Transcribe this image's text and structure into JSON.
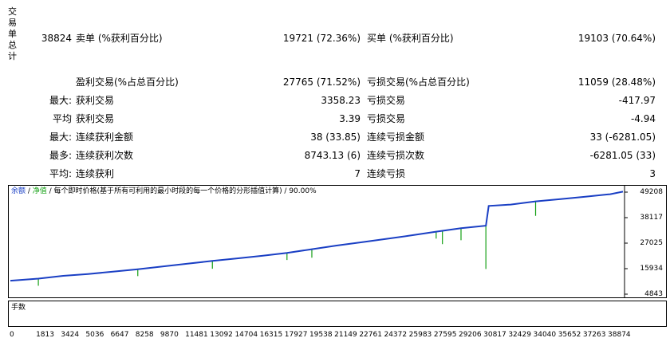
{
  "stats": {
    "side_label": "交易单总计",
    "total": "38824",
    "sell_label": "卖单 (%获利百分比)",
    "sell_value": "19721 (72.36%)",
    "buy_label": "买单 (%获利百分比)",
    "buy_value": "19103 (70.64%)",
    "profit_trades_label": "盈利交易(%占总百分比)",
    "profit_trades_value": "27765 (71.52%)",
    "loss_trades_label": "亏损交易(%占总百分比)",
    "loss_trades_value": "11059 (28.48%)",
    "rows": [
      {
        "prefix": "最大:",
        "left_label": "获利交易",
        "left_value": "3358.23",
        "right_label": "亏损交易",
        "right_value": "-417.97"
      },
      {
        "prefix": "平均",
        "left_label": "获利交易",
        "left_value": "3.39",
        "right_label": "亏损交易",
        "right_value": "-4.94"
      },
      {
        "prefix": "最大:",
        "left_label": "连续获利金额",
        "left_value": "38 (33.85)",
        "right_label": "连续亏损金额",
        "right_value": "33 (-6281.05)"
      },
      {
        "prefix": "最多:",
        "left_label": "连续获利次数",
        "left_value": "8743.13 (6)",
        "right_label": "连续亏损次数",
        "right_value": "-6281.05 (33)"
      },
      {
        "prefix": "平均:",
        "left_label": "连续获利",
        "left_value": "7",
        "right_label": "连续亏损",
        "right_value": "3"
      }
    ]
  },
  "chart": {
    "title_balance": "余额",
    "title_sep1": " / ",
    "title_equity": "净值",
    "title_rest": " / 每个即时价格(基于所有可利用的最小时段的每一个价格的分形插值计算) / 90.00%",
    "volume_label": "手数",
    "balance_color": "#1a3fc4",
    "equity_color": "#15a015"
  },
  "chart_data": {
    "type": "line",
    "series": [
      {
        "name": "余额",
        "x": [
          0,
          1813,
          3424,
          5036,
          6647,
          8258,
          9870,
          11481,
          13092,
          14704,
          16315,
          17927,
          19538,
          21149,
          22761,
          24372,
          25983,
          27595,
          29206,
          30817,
          31000,
          32429,
          34040,
          35652,
          37263,
          38874,
          39700
        ],
        "values": [
          10700,
          11600,
          12800,
          13600,
          14600,
          15700,
          16900,
          18100,
          19300,
          20400,
          21500,
          22800,
          24400,
          26000,
          27400,
          28900,
          30400,
          32000,
          33500,
          34600,
          43200,
          43800,
          45200,
          46200,
          47200,
          48300,
          49400
        ]
      },
      {
        "name": "净值",
        "x": [
          1813,
          8258,
          13092,
          17927,
          19538,
          27595,
          28000,
          29206,
          30817,
          34040
        ],
        "values": [
          8500,
          12700,
          15900,
          19700,
          20700,
          29000,
          26600,
          28300,
          15800,
          38900
        ]
      }
    ],
    "x_ticks": [
      "0",
      "1813",
      "3424",
      "5036",
      "6647",
      "8258",
      "9870",
      "11481",
      "13092",
      "14704",
      "16315",
      "17927",
      "19538",
      "21149",
      "22761",
      "24372",
      "25983",
      "27595",
      "29206",
      "30817",
      "32429",
      "34040",
      "35652",
      "37263",
      "38874"
    ],
    "y_ticks": [
      "49208",
      "38117",
      "27025",
      "15934",
      "4843"
    ],
    "xlim": [
      0,
      39700
    ],
    "ylim": [
      4843,
      49208
    ]
  }
}
